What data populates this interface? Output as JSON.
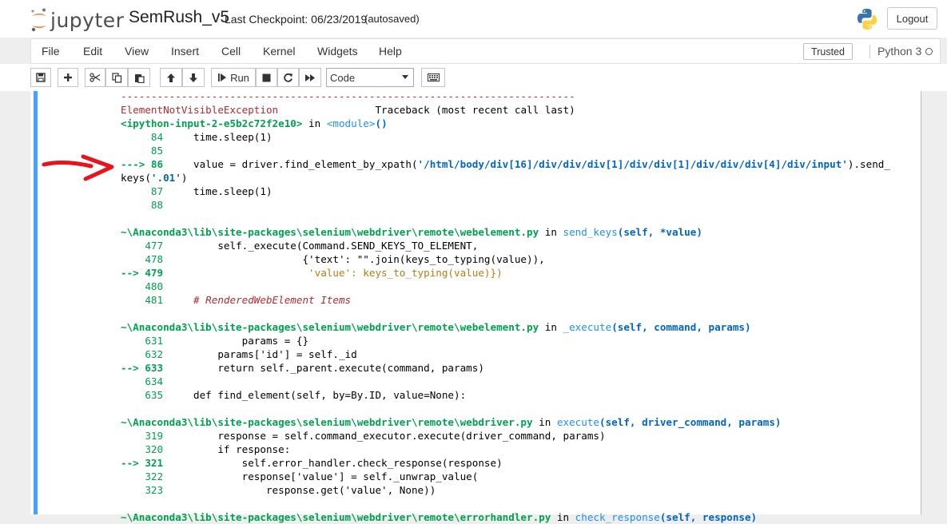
{
  "header": {
    "logo_text": "jupyter",
    "notebook_name": "SemRush_v5",
    "checkpoint": "Last Checkpoint: 06/23/2019",
    "autosave": "(autosaved)",
    "logout_label": "Logout"
  },
  "menu": {
    "items": [
      "File",
      "Edit",
      "View",
      "Insert",
      "Cell",
      "Kernel",
      "Widgets",
      "Help"
    ],
    "trusted_label": "Trusted",
    "kernel_name": "Python 3"
  },
  "toolbar": {
    "run_label": "Run",
    "cell_type": "Code",
    "icons": [
      "save-icon",
      "plus-icon",
      "cut-icon",
      "copy-icon",
      "paste-icon",
      "arrow-up-icon",
      "arrow-down-icon",
      "run-icon",
      "stop-icon",
      "restart-icon",
      "fast-forward-icon",
      "keyboard-icon"
    ]
  },
  "colors": {
    "cell_bar": "#42a5f5",
    "error_red": "#b22b31",
    "line_green": "#00a250",
    "module_cyan": "#208ffb",
    "string_blue": "#0065ca",
    "annotation_arrow": "#e8131b"
  },
  "traceback": {
    "dashes": "---------------------------------------------------------------------------",
    "exception_name": "ElementNotVisibleException",
    "traceback_header": "Traceback (most recent call last)",
    "frame1": {
      "input": "<ipython-input-2-e5b2c72f2e10>",
      "in_word": " in ",
      "module": "<module>",
      "paren": "()",
      "l84": "     84",
      "c84": "     time.sleep(1)",
      "l85": "     85",
      "arrow86": "---> 86",
      "c86a": "     value = driver.find_element_by_xpath(",
      "c86b": "'/html/body/div[16]/div/div/div[1]/div/div[1]/div/div/div[4]/div/input'",
      "c86c": ").send_",
      "c86d": "keys(",
      "c86e": "'.01'",
      "c86f": ")",
      "l87": "     87",
      "c87": "     time.sleep(1)",
      "l88": "     88"
    },
    "frame2": {
      "path": "~\\Anaconda3\\lib\\site-packages\\selenium\\webdriver\\remote\\webelement.py",
      "in_word": " in ",
      "func": "send_keys",
      "args": "(self, *value)",
      "l477": "    477",
      "c477": "         self._execute(Command.SEND_KEYS_TO_ELEMENT,",
      "l478": "    478",
      "c478a": "                       {'text': \"\".join(keys_to_typing(value)),",
      "arrow479": "--> 479",
      "c479": "                        'value': keys_to_typing(value)})",
      "l480": "    480",
      "l481": "    481",
      "c481": "     # RenderedWebElement Items"
    },
    "frame3": {
      "path": "~\\Anaconda3\\lib\\site-packages\\selenium\\webdriver\\remote\\webelement.py",
      "in_word": " in ",
      "func": "_execute",
      "args": "(self, command, params)",
      "l631": "    631",
      "c631": "             params = {}",
      "l632": "    632",
      "c632": "         params['id'] = self._id",
      "arrow633": "--> 633",
      "c633": "         return self._parent.execute(command, params)",
      "l634": "    634",
      "l635": "    635",
      "c635": "     def find_element(self, by=By.ID, value=None):"
    },
    "frame4": {
      "path": "~\\Anaconda3\\lib\\site-packages\\selenium\\webdriver\\remote\\webdriver.py",
      "in_word": " in ",
      "func": "execute",
      "args": "(self, driver_command, params)",
      "l319": "    319",
      "c319": "         response = self.command_executor.execute(driver_command, params)",
      "l320": "    320",
      "c320": "         if response:",
      "arrow321": "--> 321",
      "c321": "             self.error_handler.check_response(response)",
      "l322": "    322",
      "c322": "             response['value'] = self._unwrap_value(",
      "l323": "    323",
      "c323": "                 response.get('value', None))"
    },
    "frame5": {
      "path": "~\\Anaconda3\\lib\\site-packages\\selenium\\webdriver\\remote\\errorhandler.py",
      "in_word": " in ",
      "func": "check_response",
      "args": "(self, response)"
    }
  }
}
